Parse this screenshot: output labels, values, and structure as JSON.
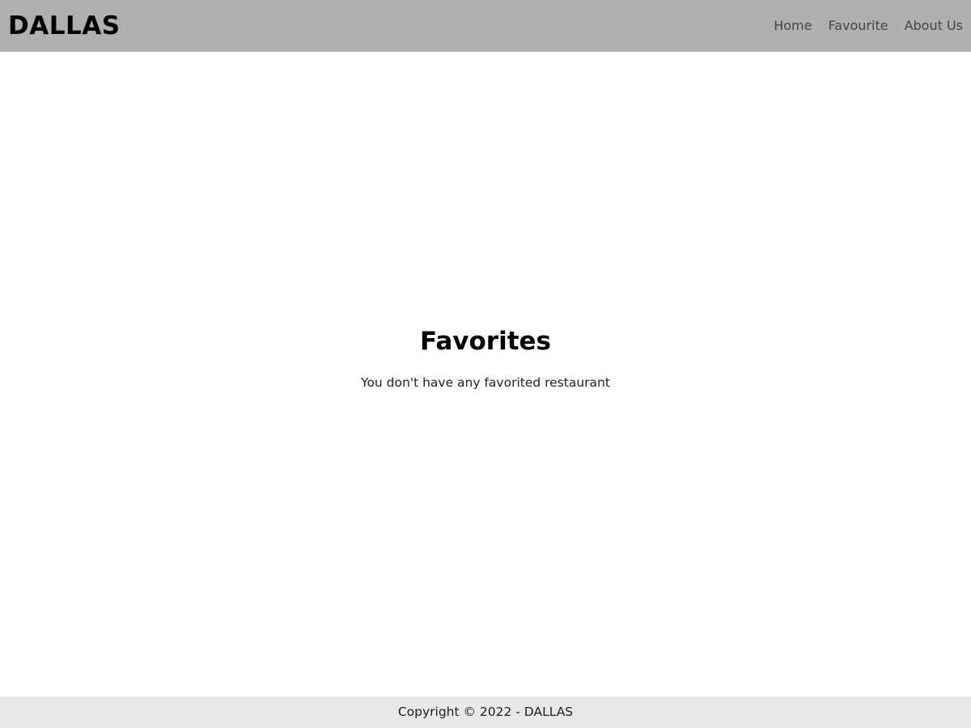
{
  "header": {
    "brand": "DALLAS",
    "nav": [
      {
        "label": "Home"
      },
      {
        "label": "Favourite"
      },
      {
        "label": "About Us"
      }
    ]
  },
  "main": {
    "title": "Favorites",
    "empty_message": "You don't have any favorited restaurant"
  },
  "footer": {
    "copyright": "Copyright © 2022 - DALLAS"
  },
  "colors": {
    "header_bg": "#b0b0b0",
    "footer_bg": "#e8e8e8",
    "page_bg": "#ffffff",
    "text": "#000000",
    "nav_text": "#444444"
  }
}
